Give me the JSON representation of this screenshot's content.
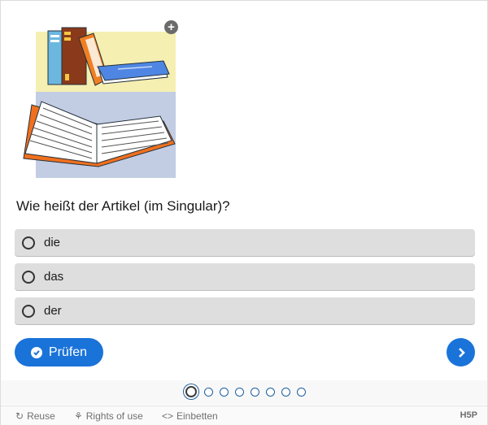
{
  "question": {
    "text": "Wie heißt der Artikel (im Singular)?",
    "zoom_icon": "plus-icon",
    "image": "books-illustration"
  },
  "answers": [
    {
      "label": "die"
    },
    {
      "label": "das"
    },
    {
      "label": "der"
    }
  ],
  "actions": {
    "check_label": "Prüfen",
    "check_icon": "checkmark-circle-icon",
    "next_icon": "chevron-right-icon"
  },
  "progress": {
    "total": 8,
    "current": 1
  },
  "footer": {
    "reuse": "Reuse",
    "rights": "Rights of use",
    "embed": "Einbetten",
    "brand": "H5P"
  },
  "colors": {
    "accent": "#1a73d9",
    "answer_bg": "#dedede"
  }
}
